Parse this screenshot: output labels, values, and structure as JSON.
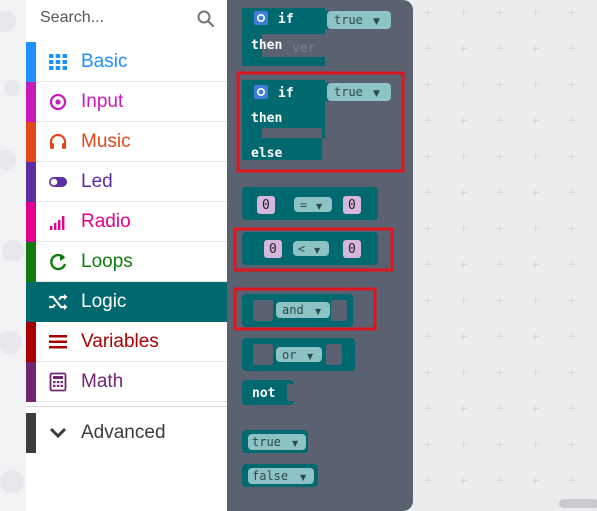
{
  "search": {
    "placeholder": "Search..."
  },
  "categories": [
    {
      "id": "basic",
      "label": "Basic",
      "icon": "grid-icon",
      "color": "#1e90ff"
    },
    {
      "id": "input",
      "label": "Input",
      "icon": "target-icon",
      "color": "#c71bb9"
    },
    {
      "id": "music",
      "label": "Music",
      "icon": "headphones-icon",
      "color": "#e2481a"
    },
    {
      "id": "led",
      "label": "Led",
      "icon": "toggle-icon",
      "color": "#5d2ea3"
    },
    {
      "id": "radio",
      "label": "Radio",
      "icon": "signal-bars-icon",
      "color": "#e3008c"
    },
    {
      "id": "loops",
      "label": "Loops",
      "icon": "refresh-icon",
      "color": "#107c10"
    },
    {
      "id": "logic",
      "label": "Logic",
      "icon": "shuffle-icon",
      "color": "#006970",
      "selected": true
    },
    {
      "id": "variables",
      "label": "Variables",
      "icon": "list-icon",
      "color": "#a80000"
    },
    {
      "id": "math",
      "label": "Math",
      "icon": "calculator-icon",
      "color": "#712672"
    },
    {
      "id": "advanced",
      "label": "Advanced",
      "icon": "chevron-down-icon",
      "color": "#3c3c3c"
    }
  ],
  "blocks": {
    "if": "if",
    "then": "then",
    "else": "else",
    "true": "true",
    "false": "false",
    "zero": "0",
    "eq": "=",
    "lt": "<",
    "and": "and",
    "or": "or",
    "not": "not",
    "behind_text": "ver"
  },
  "colors": {
    "logic_block": "#006970",
    "dropdown_fill": "#8ec3c6",
    "number_slot": "#d7b7dd",
    "highlight": "#e0161f",
    "flyout_bg": "#5a6170"
  }
}
